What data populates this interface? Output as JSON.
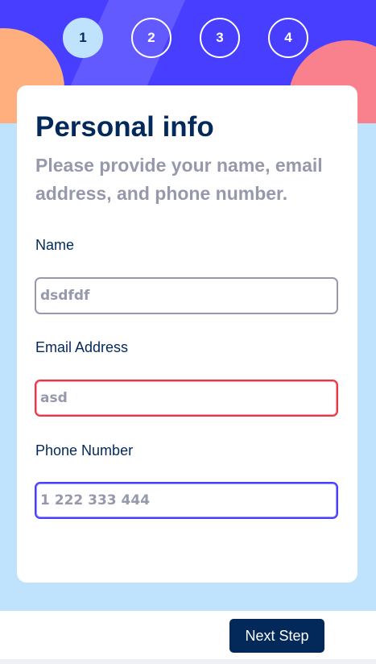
{
  "steps": [
    {
      "number": "1",
      "active": true
    },
    {
      "number": "2",
      "active": false
    },
    {
      "number": "3",
      "active": false
    },
    {
      "number": "4",
      "active": false
    }
  ],
  "card": {
    "title": "Personal info",
    "subtitle": "Please provide your name, email address, and phone number."
  },
  "form": {
    "name": {
      "label": "Name",
      "value": "dsdfdf"
    },
    "email": {
      "label": "Email Address",
      "value": "asd",
      "state": "error"
    },
    "phone": {
      "label": "Phone Number",
      "value": "1 222 333 444",
      "state": "focused"
    }
  },
  "footer": {
    "next_label": "Next Step"
  },
  "colors": {
    "banner": "#483eff",
    "active_step": "#bfe2fd",
    "title": "#02295a",
    "muted": "#9699ab",
    "error": "#ed3548",
    "focus": "#483eff"
  }
}
